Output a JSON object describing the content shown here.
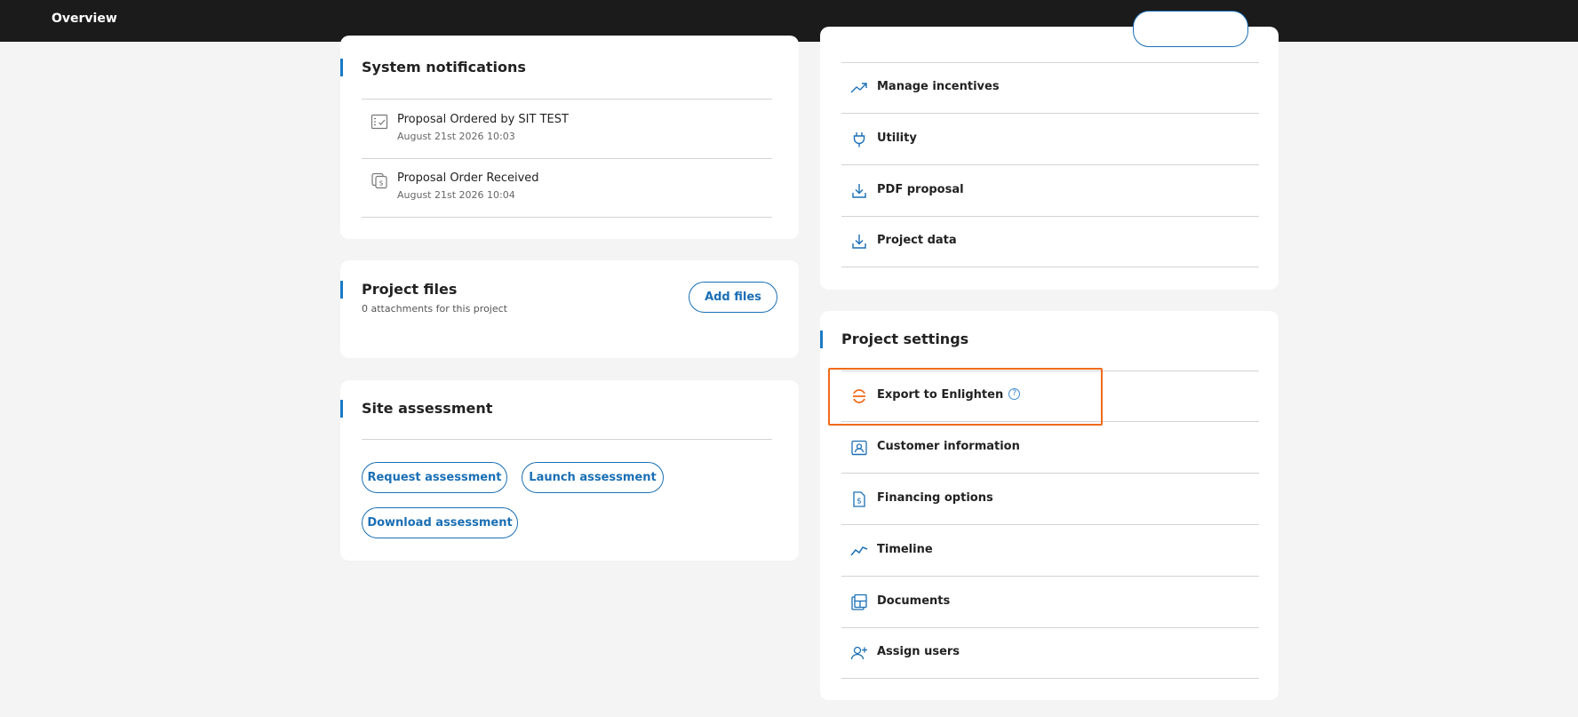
{
  "header": {
    "title": "Overview"
  },
  "system_notifications": {
    "title": "System notifications",
    "items": [
      {
        "title": "Proposal Ordered by SIT TEST",
        "date": "August 21st 2026 10:03",
        "icon": "checklist-icon"
      },
      {
        "title": "Proposal Order Received",
        "date": "August 21st 2026 10:04",
        "icon": "document-dollar-icon"
      }
    ]
  },
  "project_files": {
    "title": "Project files",
    "subtitle": "0 attachments for this project",
    "add_button": "Add files"
  },
  "site_assessment": {
    "title": "Site assessment",
    "buttons": {
      "request": "Request assessment",
      "launch": "Launch assessment",
      "download": "Download assessment"
    }
  },
  "proposal_actions": {
    "items": [
      {
        "label": "Manage incentives",
        "icon": "trend-up-icon"
      },
      {
        "label": "Utility",
        "icon": "plug-icon"
      },
      {
        "label": "PDF proposal",
        "icon": "download-icon"
      },
      {
        "label": "Project data",
        "icon": "download-icon"
      }
    ]
  },
  "project_settings": {
    "title": "Project settings",
    "items": [
      {
        "label": "Export to Enlighten",
        "icon": "enlighten-logo-icon",
        "help": "?"
      },
      {
        "label": "Customer information",
        "icon": "contact-card-icon"
      },
      {
        "label": "Financing options",
        "icon": "dollar-document-icon"
      },
      {
        "label": "Timeline",
        "icon": "timeline-icon"
      },
      {
        "label": "Documents",
        "icon": "documents-icon"
      },
      {
        "label": "Assign users",
        "icon": "add-user-icon"
      }
    ]
  },
  "colors": {
    "accent": "#1a7ac7",
    "highlight": "#f06a19",
    "topbar": "#1b1b1b",
    "background": "#f4f4f4"
  }
}
